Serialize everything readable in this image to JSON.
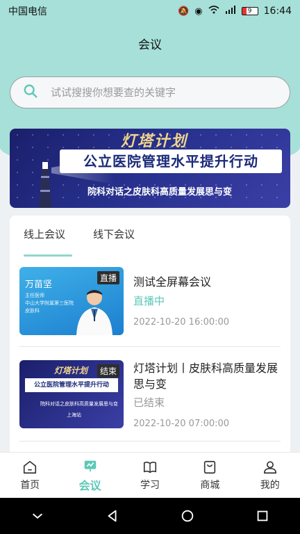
{
  "status": {
    "carrier": "中国电信",
    "battery": "9",
    "time": "16:44",
    "signal": "4G"
  },
  "header": {
    "title": "会议"
  },
  "search": {
    "placeholder": "试试搜搜你想要查的关键字"
  },
  "banner": {
    "script_title": "灯塔计划",
    "title": "公立医院管理水平提升行动",
    "subtitle": "院科对话之皮肤科高质量发展思与变"
  },
  "tabs": [
    {
      "label": "线上会议",
      "active": true
    },
    {
      "label": "线下会议",
      "active": false
    }
  ],
  "meetings": [
    {
      "badge": "直播",
      "thumb_name": "万苗坚",
      "thumb_info": [
        "主任医师",
        "中山大学附属第三医院",
        "皮肤科"
      ],
      "title": "测试全屏幕会议",
      "status": "直播中",
      "status_color": "#5cc9b8",
      "time": "2022-10-20 16:00:00"
    },
    {
      "badge": "结束",
      "thumb_script": "灯塔计划",
      "thumb_title": "公立医院管理水平提升行动",
      "thumb_sub": "院科对话之皮肤科高质量发展思与变",
      "thumb_city": "上海站",
      "title": "灯塔计划丨皮肤科高质量发展思与变",
      "status": "已结束",
      "status_color": "#999999",
      "time": "2022-10-20 07:00:00"
    }
  ],
  "tabbar": [
    {
      "label": "首页",
      "icon": "home-icon",
      "active": false
    },
    {
      "label": "会议",
      "icon": "meeting-icon",
      "active": true
    },
    {
      "label": "学习",
      "icon": "book-icon",
      "active": false
    },
    {
      "label": "商城",
      "icon": "shop-icon",
      "active": false
    },
    {
      "label": "我的",
      "icon": "user-icon",
      "active": false
    }
  ],
  "colors": {
    "accent": "#5cc9b8",
    "header_bg": "#a6e0d8"
  }
}
